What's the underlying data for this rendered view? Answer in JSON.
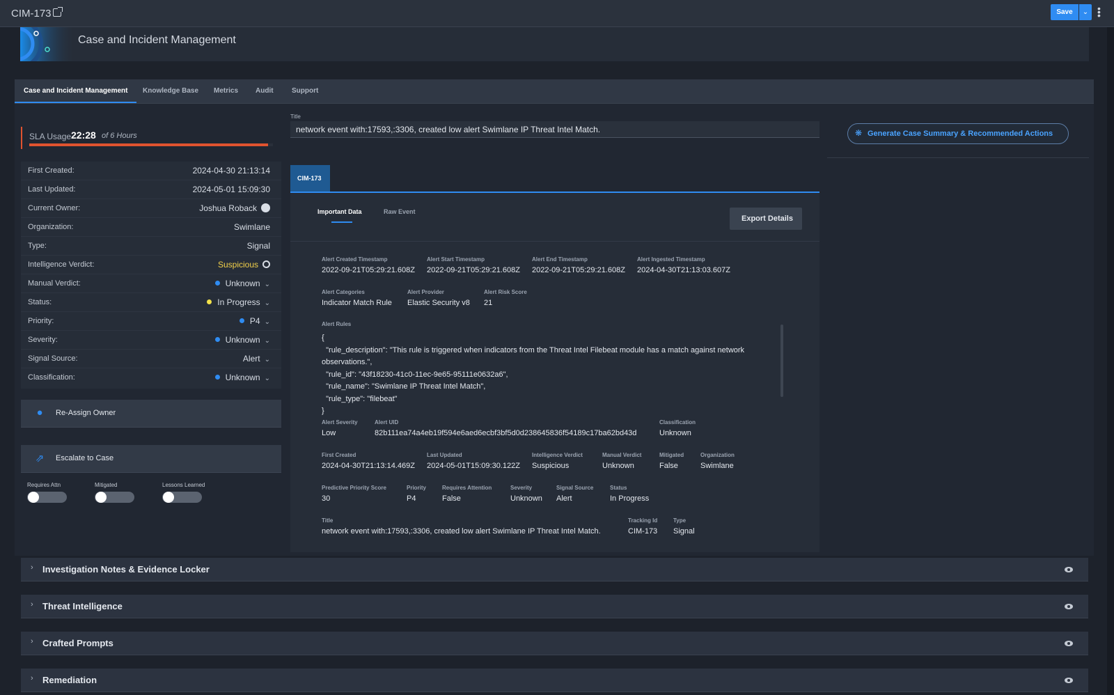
{
  "topbar": {
    "record_id": "CIM-173",
    "save_label": "Save"
  },
  "banner": {
    "title": "Case and Incident Management"
  },
  "tabs": [
    {
      "label": "Case and Incident Management"
    },
    {
      "label": "Knowledge Base"
    },
    {
      "label": "Metrics"
    },
    {
      "label": "Audit"
    },
    {
      "label": "Support"
    }
  ],
  "sla": {
    "label": "SLA Usage",
    "value": "22:28",
    "of": "of 6 Hours",
    "progress": 0.98
  },
  "details": [
    {
      "key": "First Created:",
      "value": "2024-04-30 21:13:14"
    },
    {
      "key": "Last Updated:",
      "value": "2024-05-01 15:09:30"
    },
    {
      "key": "Current Owner:",
      "value": "Joshua Roback"
    },
    {
      "key": "Organization:",
      "value": "Swimlane"
    },
    {
      "key": "Type:",
      "value": "Signal"
    },
    {
      "key": "Intelligence Verdict:",
      "value": "Suspicious"
    },
    {
      "key": "Manual Verdict:",
      "value": "Unknown"
    },
    {
      "key": "Status:",
      "value": "In Progress"
    },
    {
      "key": "Priority:",
      "value": "P4"
    },
    {
      "key": "Severity:",
      "value": "Unknown"
    },
    {
      "key": "Signal Source:",
      "value": "Alert"
    },
    {
      "key": "Classification:",
      "value": "Unknown"
    }
  ],
  "colors": {
    "blue": "#2f8cf2",
    "yellow": "#f2d04a",
    "sla_bar": "#e0532f"
  },
  "actions": {
    "reassign": "Re-Assign Owner",
    "escalate": "Escalate to Case"
  },
  "toggles": [
    {
      "label": "Requires Attn",
      "on": false
    },
    {
      "label": "Mitigated",
      "on": false
    },
    {
      "label": "Lessons Learned",
      "on": false
    }
  ],
  "title_field": {
    "label": "Title",
    "value": "network event with:17593,:3306, created low alert Swimlane IP Threat Intel Match."
  },
  "generate_button": "Generate Case Summary & Recommended Actions",
  "record_tab": "CIM-173",
  "sub_tabs": {
    "important": "Important Data",
    "raw": "Raw Event"
  },
  "export_button": "Export Details",
  "fields": {
    "alert_created": {
      "k": "Alert Created Timestamp",
      "v": "2022-09-21T05:29:21.608Z"
    },
    "alert_start": {
      "k": "Alert Start Timestamp",
      "v": "2022-09-21T05:29:21.608Z"
    },
    "alert_end": {
      "k": "Alert End Timestamp",
      "v": "2022-09-21T05:29:21.608Z"
    },
    "alert_ingested": {
      "k": "Alert Ingested Timestamp",
      "v": "2024-04-30T21:13:03.607Z"
    },
    "alert_categories": {
      "k": "Alert Categories",
      "v": "Indicator Match Rule"
    },
    "alert_provider": {
      "k": "Alert Provider",
      "v": "Elastic Security v8"
    },
    "alert_risk": {
      "k": "Alert Risk Score",
      "v": "21"
    },
    "alert_rules_label": "Alert Rules",
    "alert_rules": "{\n  \"rule_description\": \"This rule is triggered when indicators from the Threat Intel Filebeat module has a match against network observations.\",\n  \"rule_id\": \"43f18230-41c0-11ec-9e65-95111e0632a6\",\n  \"rule_name\": \"Swimlane IP Threat Intel Match\",\n  \"rule_type\": \"filebeat\"\n}",
    "alert_severity": {
      "k": "Alert Severity",
      "v": "Low"
    },
    "alert_uid": {
      "k": "Alert UID",
      "v": "82b111ea74a4eb19f594e6aed6ecbf3bf5d0d238645836f54189c17ba62bd43d"
    },
    "classification": {
      "k": "Classification",
      "v": "Unknown"
    },
    "first_created": {
      "k": "First Created",
      "v": "2024-04-30T21:13:14.469Z"
    },
    "last_updated": {
      "k": "Last Updated",
      "v": "2024-05-01T15:09:30.122Z"
    },
    "intel_verdict": {
      "k": "Intelligence Verdict",
      "v": "Suspicious"
    },
    "manual_verdict": {
      "k": "Manual Verdict",
      "v": "Unknown"
    },
    "mitigated": {
      "k": "Mitigated",
      "v": "False"
    },
    "organization": {
      "k": "Organization",
      "v": "Swimlane"
    },
    "pps": {
      "k": "Predictive Priority Score",
      "v": "30"
    },
    "priority": {
      "k": "Priority",
      "v": "P4"
    },
    "requires_attention": {
      "k": "Requires Attention",
      "v": "False"
    },
    "severity": {
      "k": "Severity",
      "v": "Unknown"
    },
    "signal_source": {
      "k": "Signal Source",
      "v": "Alert"
    },
    "status": {
      "k": "Status",
      "v": "In Progress"
    },
    "title": {
      "k": "Title",
      "v": "network event with:17593,:3306, created low alert Swimlane IP Threat Intel Match."
    },
    "tracking_id": {
      "k": "Tracking Id",
      "v": "CIM-173"
    },
    "type": {
      "k": "Type",
      "v": "Signal"
    }
  },
  "accordions": [
    {
      "label": "Investigation Notes & Evidence Locker"
    },
    {
      "label": "Threat Intelligence"
    },
    {
      "label": "Crafted Prompts"
    },
    {
      "label": "Remediation"
    }
  ]
}
